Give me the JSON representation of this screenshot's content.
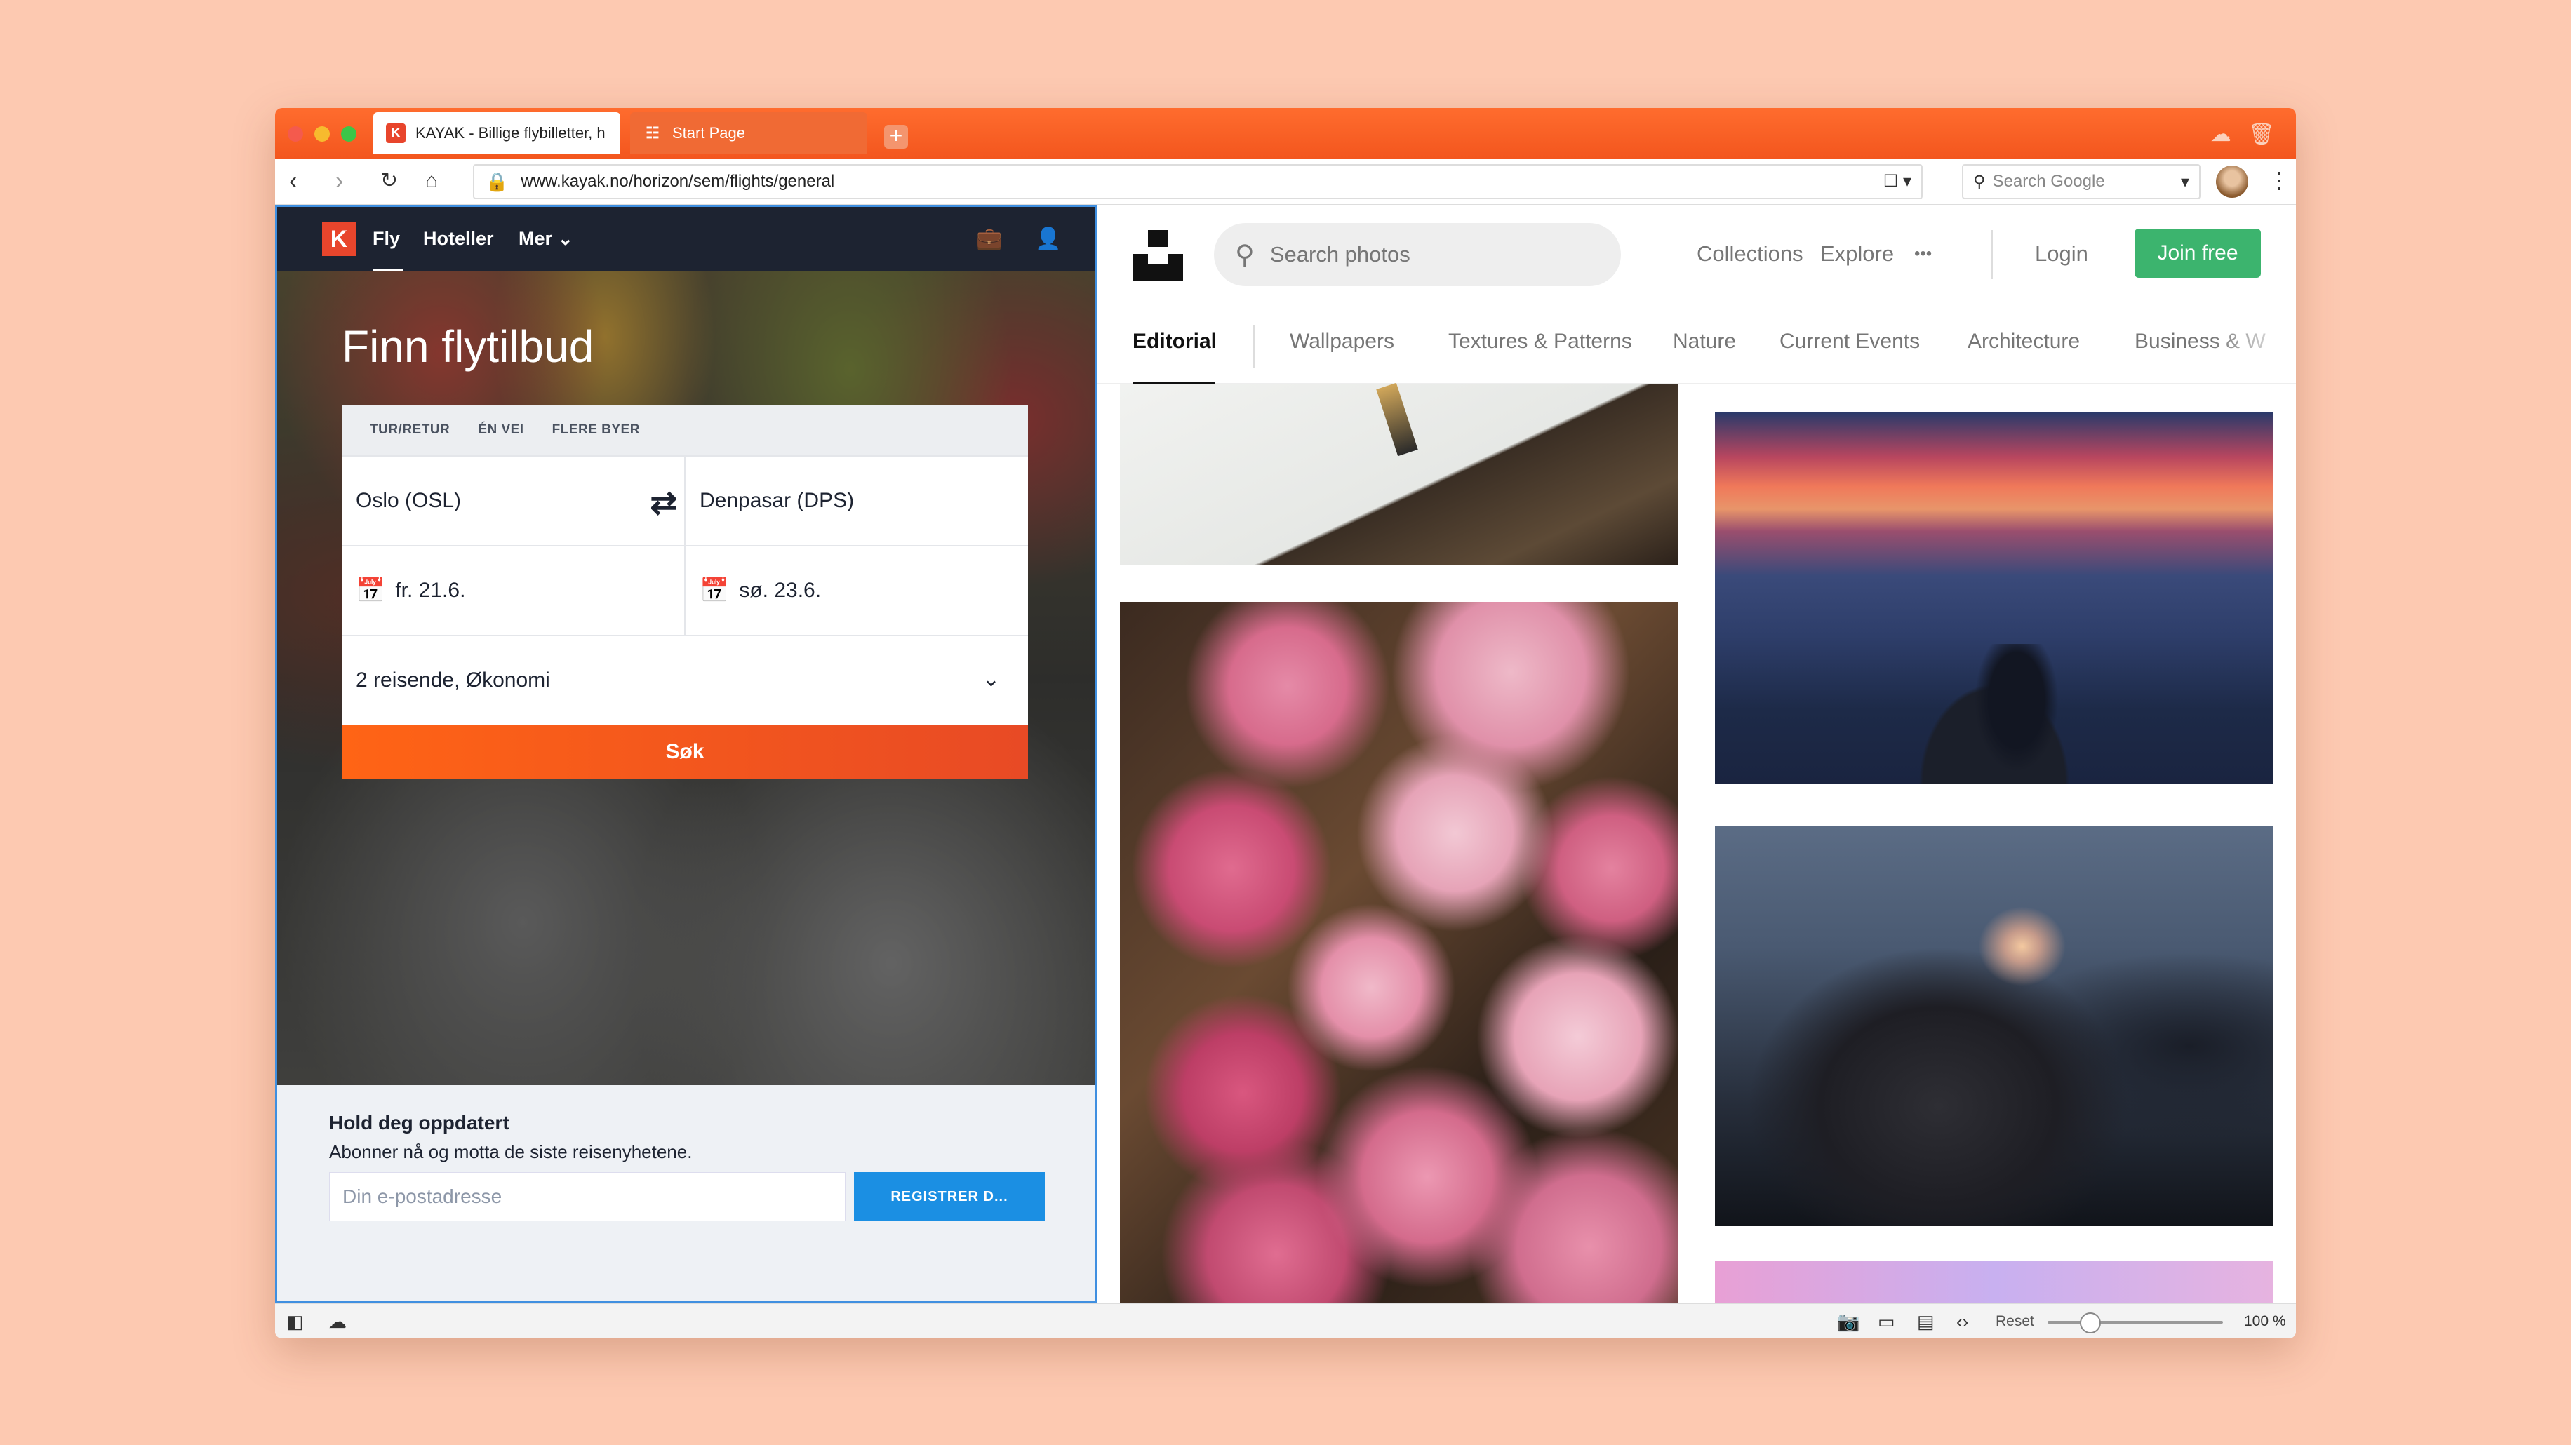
{
  "browser": {
    "tabs": [
      {
        "favicon": "K",
        "title": "KAYAK - Billige flybilletter, h"
      },
      {
        "favicon": "☷",
        "title": "Start Page"
      }
    ],
    "new_tab_label": "+",
    "url": "www.kayak.no/horizon/sem/flights/general",
    "search_placeholder": "Search Google",
    "icons": [
      "back-icon",
      "forward-icon",
      "reload-icon",
      "home-icon",
      "lock-icon",
      "bookmark-icon",
      "cloud-icon",
      "trash-icon",
      "menu-icon"
    ]
  },
  "kayak": {
    "nav": {
      "logo": "K",
      "items": [
        "Fly",
        "Hoteller",
        "Mer ⌄"
      ]
    },
    "hero_title": "Finn flytilbud",
    "trip_types": [
      "TUR/RETUR",
      "ÉN VEI",
      "FLERE BYER"
    ],
    "origin": "Oslo (OSL)",
    "destination": "Denpasar (DPS)",
    "depart_date": "fr. 21.6.",
    "return_date": "sø. 23.6.",
    "travelers": "2 reisende, Økonomi",
    "search_button": "Søk",
    "newsletter": {
      "title": "Hold deg oppdatert",
      "subtitle": "Abonner nå og motta de siste reisenyhetene.",
      "email_placeholder": "Din e-postadresse",
      "register_button": "REGISTRER D..."
    }
  },
  "unsplash": {
    "search_placeholder": "Search photos",
    "links": {
      "collections": "Collections",
      "explore": "Explore",
      "more": "•••",
      "login": "Login",
      "join": "Join free"
    },
    "categories": [
      "Editorial",
      "Wallpapers",
      "Textures & Patterns",
      "Nature",
      "Current Events",
      "Architecture",
      "Business & W"
    ],
    "active_category": "Editorial"
  },
  "statusbar": {
    "reset_label": "Reset",
    "zoom": "100 %"
  }
}
